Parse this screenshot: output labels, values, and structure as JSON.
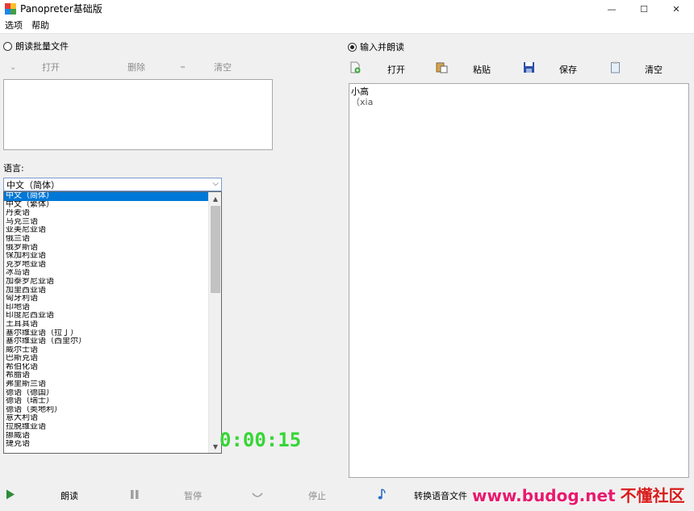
{
  "window": {
    "title": "Panopreter基础版",
    "controls": {
      "minimize": "—",
      "maximize": "☐",
      "close": "✕"
    }
  },
  "menu": [
    "选项",
    "帮助"
  ],
  "left": {
    "radio_label": "朗读批量文件",
    "radio_checked": false,
    "toolbar": {
      "open": "打开",
      "delete": "删除",
      "clear": "清空"
    },
    "language_label": "语言:",
    "language_selected": "中文（简体）",
    "languages": [
      "中文（简体）",
      "中文（繁体）",
      "丹麦语",
      "乌克兰语",
      "亚美尼亚语",
      "俄兰语",
      "俄罗斯语",
      "保加利亚语",
      "克罗地亚语",
      "冰岛语",
      "加泰罗尼亚语",
      "加里西亚语",
      "匈牙利语",
      "印地语",
      "印度尼西亚语",
      "土耳其语",
      "塞尔维亚语（拉丁）",
      "塞尔维亚语（西里尔）",
      "威尔士语",
      "巴斯克语",
      "希伯化语",
      "希腊语",
      "弗里斯兰语",
      "德语（德国）",
      "德语（瑞士）",
      "德语（奥地利）",
      "意大利语",
      "拉脱维亚语",
      "挪威语",
      "捷克语"
    ],
    "timer": "0:00:15"
  },
  "right": {
    "radio_label": "输入并朗读",
    "radio_checked": true,
    "toolbar": {
      "open": "打开",
      "paste": "粘贴",
      "save": "保存",
      "clear": "清空"
    },
    "text_lines": [
      "小高",
      "（xia"
    ]
  },
  "bottom": {
    "read": "朗读",
    "pause": "暂停",
    "stop": "停止",
    "convert": "转换语音文件"
  },
  "watermark": {
    "url": "www.budog.net",
    "brand": "不懂社区"
  },
  "colors": {
    "accent": "#0078d7",
    "timer": "#35d635",
    "watermark": "#e8196e"
  }
}
